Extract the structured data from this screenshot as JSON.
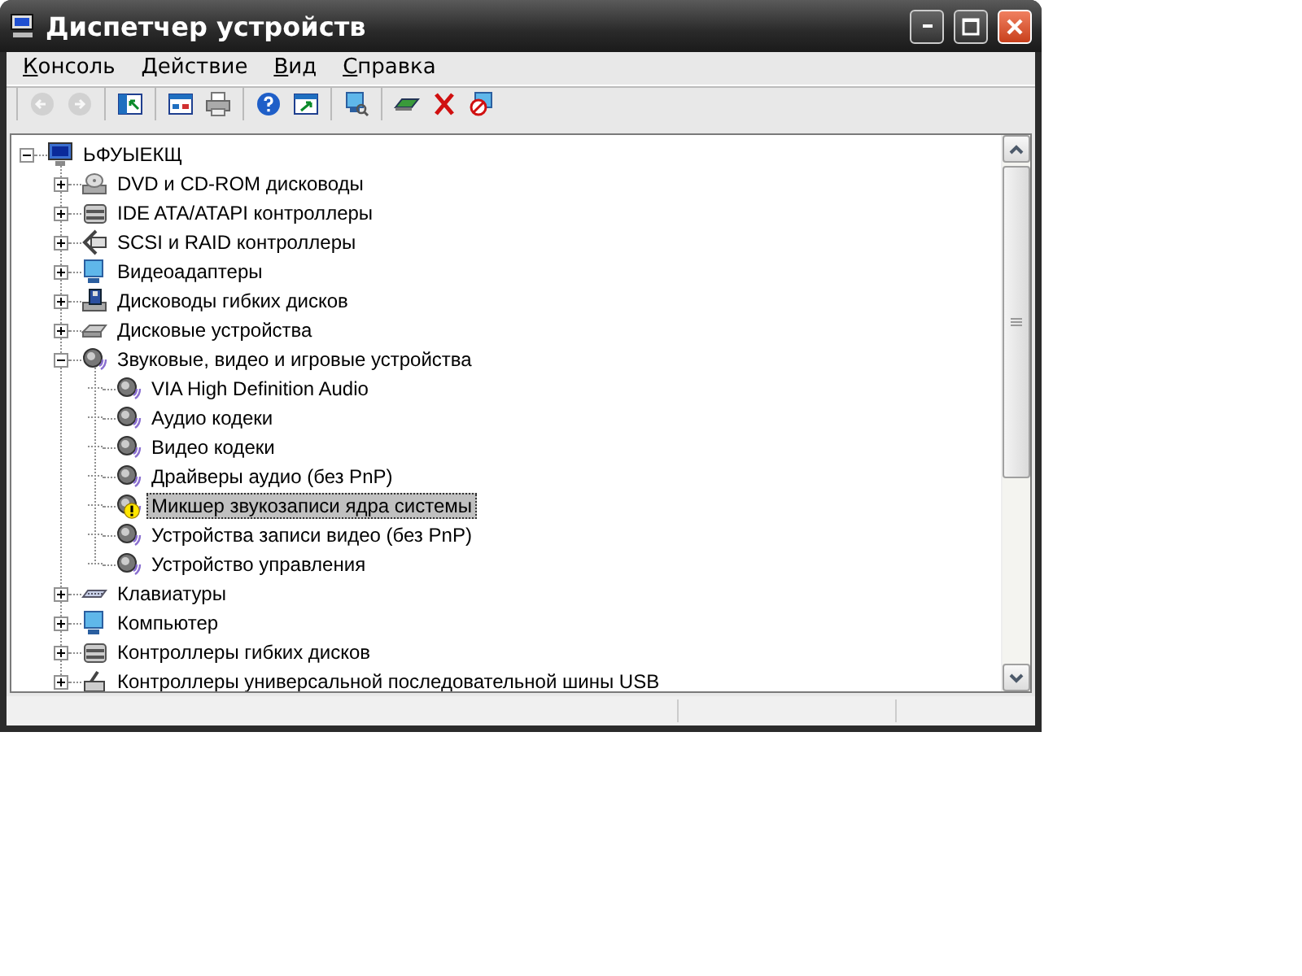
{
  "window": {
    "title": "Диспетчер устройств"
  },
  "menu": [
    {
      "label": "Консоль"
    },
    {
      "label": "Действие"
    },
    {
      "label": "Вид"
    },
    {
      "label": "Справка"
    }
  ],
  "toolbar": {
    "groups": [
      [
        {
          "disabled": true
        },
        {
          "disabled": true
        }
      ],
      [
        {
          "disabled": false
        }
      ],
      [
        {
          "disabled": false
        },
        {
          "disabled": false
        }
      ],
      [
        {
          "disabled": false
        },
        {
          "disabled": false
        }
      ],
      [
        {
          "disabled": false
        }
      ],
      [
        {
          "disabled": false
        },
        {
          "disabled": false
        },
        {
          "disabled": false
        }
      ]
    ]
  },
  "tree": [
    {
      "label": "ЬФУЫЕКЩ",
      "kind": "computer",
      "expanded": true,
      "selected": false,
      "warning": false,
      "children": [
        {
          "label": "DVD и CD-ROM дисководы",
          "kind": "optical",
          "expanded": false,
          "selected": false,
          "warning": false
        },
        {
          "label": "IDE ATA/ATAPI контроллеры",
          "kind": "controller",
          "expanded": false,
          "selected": false,
          "warning": false
        },
        {
          "label": "SCSI и RAID контроллеры",
          "kind": "scsi",
          "expanded": false,
          "selected": false,
          "warning": false
        },
        {
          "label": "Видеоадаптеры",
          "kind": "display",
          "expanded": false,
          "selected": false,
          "warning": false
        },
        {
          "label": "Дисководы гибких дисков",
          "kind": "floppy",
          "expanded": false,
          "selected": false,
          "warning": false
        },
        {
          "label": "Дисковые устройства",
          "kind": "disk",
          "expanded": false,
          "selected": false,
          "warning": false
        },
        {
          "label": "Звуковые, видео и игровые устройства",
          "kind": "sound",
          "expanded": true,
          "selected": false,
          "warning": false,
          "children": [
            {
              "label": "VIA High Definition Audio",
              "kind": "sound",
              "selected": false,
              "warning": false
            },
            {
              "label": "Аудио кодеки",
              "kind": "sound",
              "selected": false,
              "warning": false
            },
            {
              "label": "Видео кодеки",
              "kind": "sound",
              "selected": false,
              "warning": false
            },
            {
              "label": "Драйверы аудио (без PnP)",
              "kind": "sound",
              "selected": false,
              "warning": false
            },
            {
              "label": "Микшер звукозаписи ядра системы",
              "kind": "sound",
              "selected": true,
              "warning": true
            },
            {
              "label": "Устройства записи видео (без PnP)",
              "kind": "sound",
              "selected": false,
              "warning": false
            },
            {
              "label": "Устройство управления",
              "kind": "sound",
              "selected": false,
              "warning": false
            }
          ]
        },
        {
          "label": "Клавиатуры",
          "kind": "keyboard",
          "expanded": false,
          "selected": false,
          "warning": false
        },
        {
          "label": "Компьютер",
          "kind": "display",
          "expanded": false,
          "selected": false,
          "warning": false
        },
        {
          "label": "Контроллеры гибких дисков",
          "kind": "controller",
          "expanded": false,
          "selected": false,
          "warning": false
        },
        {
          "label": "Контроллеры универсальной последовательной шины USB",
          "kind": "usb",
          "expanded": false,
          "selected": false,
          "warning": false
        }
      ]
    }
  ]
}
